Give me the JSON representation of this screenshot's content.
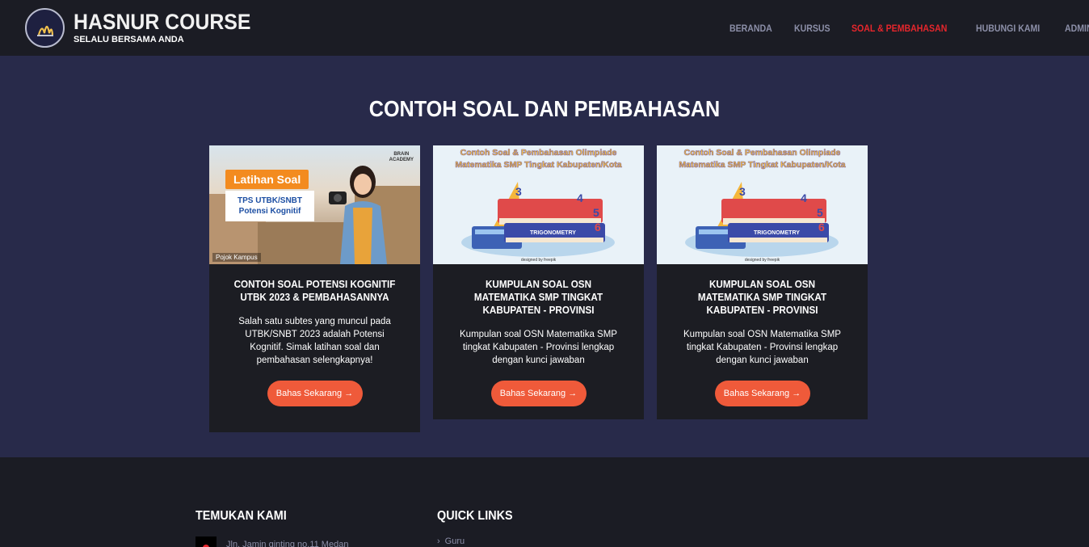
{
  "header": {
    "brand_title": "HASNUR COURSE",
    "brand_subtitle": "SELALU BERSAMA ANDA",
    "nav": [
      {
        "label": "BERANDA",
        "active": false
      },
      {
        "label": "KURSUS",
        "active": false
      },
      {
        "label": "SOAL & PEMBAHASAN",
        "active": true
      },
      {
        "label": "HUBUNGI KAMI",
        "active": false
      },
      {
        "label": "ADMIN",
        "active": false
      }
    ]
  },
  "main": {
    "title": "CONTOH SOAL DAN PEMBAHASAN",
    "cards": [
      {
        "title": "CONTOH SOAL POTENSI KOGNITIF UTBK 2023 & PEMBAHASANNYA",
        "description": "Salah satu subtes yang muncul pada UTBK/SNBT 2023 adalah Potensi Kognitif. Simak latihan soal dan pembahasan selengkapnya!",
        "button": "Bahas Sekarang →",
        "image": {
          "tag": "Latihan Soal",
          "subtitle_line1": "TPS UTBK/SNBT",
          "subtitle_line2": "Potensi Kognitif",
          "logo_line1": "BRAIN",
          "logo_line2": "ACADEMY",
          "footer": "Pojok Kampus"
        }
      },
      {
        "title": "KUMPULAN SOAL OSN MATEMATIKA SMP TINGKAT KABUPATEN - PROVINSI",
        "description": "Kumpulan soal OSN Matematika SMP tingkat Kabupaten - Provinsi lengkap dengan kunci jawaban",
        "button": "Bahas Sekarang →",
        "image": {
          "caption_line1": "Contoh Soal & Pembahasan Olimpiade",
          "caption_line2": "Matematika SMP Tingkat Kabupaten/Kota",
          "book_label": "TRIGONOMETRY",
          "credit": "designed by freepik"
        }
      },
      {
        "title": "KUMPULAN SOAL OSN MATEMATIKA SMP TINGKAT KABUPATEN - PROVINSI",
        "description": "Kumpulan soal OSN Matematika SMP tingkat Kabupaten - Provinsi lengkap dengan kunci jawaban",
        "button": "Bahas Sekarang →",
        "image": {
          "caption_line1": "Contoh Soal & Pembahasan Olimpiade",
          "caption_line2": "Matematika SMP Tingkat Kabupaten/Kota",
          "book_label": "TRIGONOMETRY",
          "credit": "designed by freepik"
        }
      }
    ]
  },
  "footer": {
    "col1_title": "TEMUKAN KAMI",
    "col1_item": "Jln. Jamin ginting no.11 Medan",
    "col2_title": "QUICK LINKS",
    "col2_item": "Guru"
  },
  "colors": {
    "header_bg": "#1b1c24",
    "main_bg": "#282a4a",
    "card_bg": "#1c1d23",
    "accent_button": "#ef5a3a",
    "nav_active": "#e7262c",
    "nav_inactive": "#8c8fa8"
  }
}
